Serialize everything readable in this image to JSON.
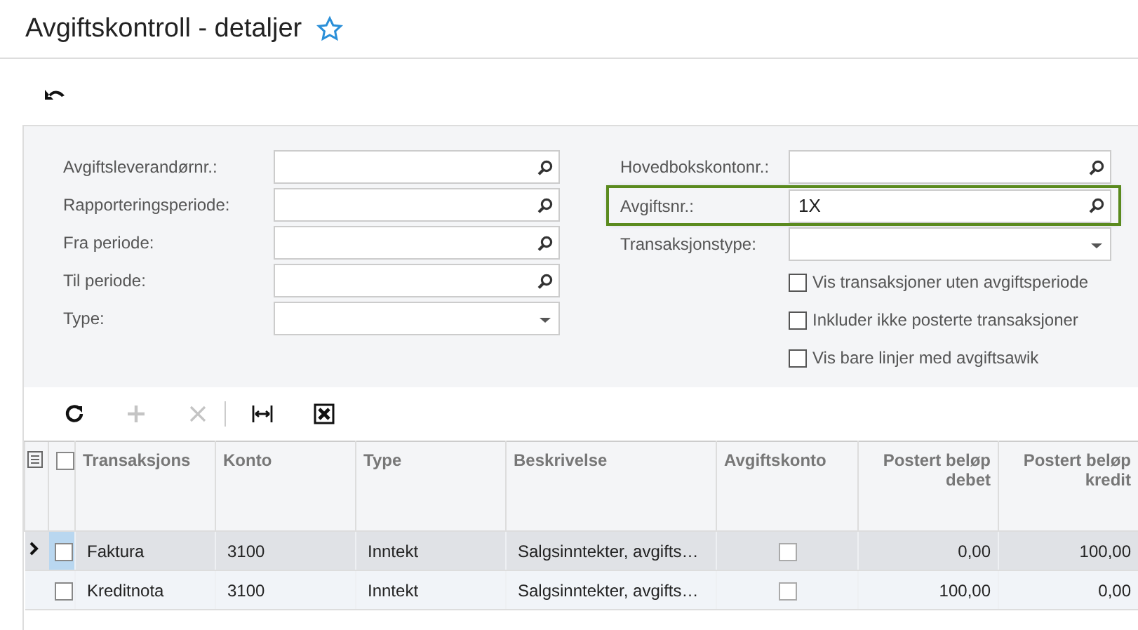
{
  "page_title": "Avgiftskontroll - detaljer",
  "filters": {
    "left": [
      {
        "label": "Avgiftsleverandørnr.:",
        "kind": "lookup",
        "highlighted": false
      },
      {
        "label": "Rapporteringsperiode:",
        "kind": "lookup",
        "highlighted": false
      },
      {
        "label": "Fra periode:",
        "kind": "lookup",
        "highlighted": false
      },
      {
        "label": "Til periode:",
        "kind": "lookup",
        "highlighted": false
      },
      {
        "label": "Type:",
        "kind": "select",
        "highlighted": false
      }
    ],
    "right": [
      {
        "label": "Hovedbokskontonr.:",
        "kind": "lookup",
        "highlighted": false
      },
      {
        "label": "Avgiftsnr.:",
        "kind": "lookup",
        "value": "1X",
        "highlighted": true
      },
      {
        "label": "Transaksjonstype:",
        "kind": "select",
        "highlighted": false
      }
    ],
    "checkboxes": [
      {
        "label": "Vis transaksjoner uten avgiftsperiode",
        "checked": false
      },
      {
        "label": "Inkluder ikke posterte transaksjoner",
        "checked": false
      },
      {
        "label": "Vis bare linjer med avgiftsawik",
        "checked": false
      }
    ]
  },
  "toolbar": [
    {
      "kind": "refresh",
      "disabled": false
    },
    {
      "kind": "add",
      "disabled": true
    },
    {
      "kind": "delete",
      "disabled": true
    },
    {
      "kind": "fit",
      "disabled": false
    },
    {
      "kind": "excel",
      "disabled": false
    }
  ],
  "table": {
    "header_checked": false,
    "columns": [
      {
        "label": "Transaksjons",
        "kind": "text"
      },
      {
        "label": "Konto",
        "kind": "text"
      },
      {
        "label": "Type",
        "kind": "text"
      },
      {
        "label": "Beskrivelse",
        "kind": "text"
      },
      {
        "label": "Avgiftskonto",
        "kind": "check"
      },
      {
        "label": "Postert beløp debet",
        "kind": "number"
      },
      {
        "label": "Postert beløp kredit",
        "kind": "number"
      }
    ],
    "rows": [
      {
        "selected": true,
        "checked": false,
        "cells": [
          {
            "text": "Faktura"
          },
          {
            "text": "3100"
          },
          {
            "text": "Inntekt"
          },
          {
            "text": "Salgsinntekter, avgifts…"
          },
          {
            "checked": false
          },
          {
            "text": "0,00"
          },
          {
            "text": "100,00"
          }
        ]
      },
      {
        "selected": false,
        "checked": false,
        "cells": [
          {
            "text": "Kreditnota"
          },
          {
            "text": "3100"
          },
          {
            "text": "Inntekt"
          },
          {
            "text": "Salgsinntekter, avgifts…"
          },
          {
            "checked": false
          },
          {
            "text": "100,00"
          },
          {
            "text": "0,00"
          }
        ]
      }
    ]
  }
}
